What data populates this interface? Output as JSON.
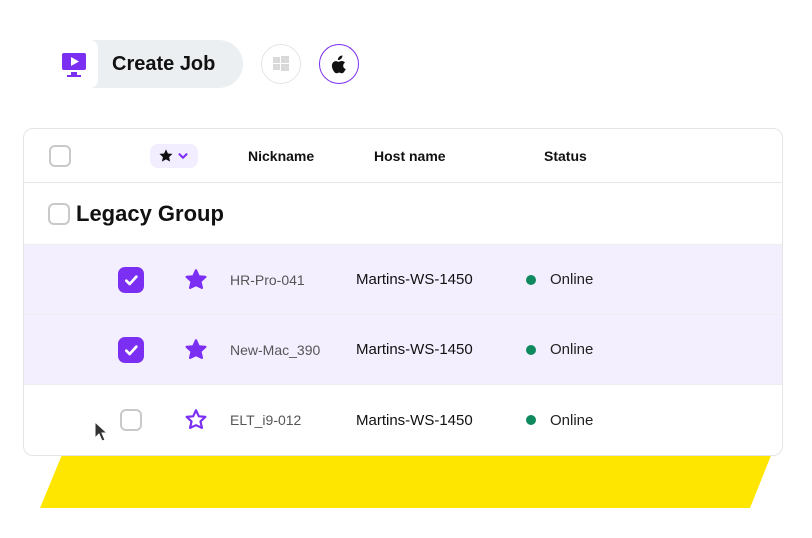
{
  "toolbar": {
    "create_label": "Create Job"
  },
  "table": {
    "headers": {
      "nickname": "Nickname",
      "hostname": "Host name",
      "status": "Status"
    },
    "group": {
      "name": "Legacy Group"
    },
    "rows": [
      {
        "checked": true,
        "favorite": true,
        "nickname": "HR-Pro-041",
        "hostname": "Martins-WS-1450",
        "status": "Online",
        "selected": true
      },
      {
        "checked": true,
        "favorite": true,
        "nickname": "New-Mac_390",
        "hostname": "Martins-WS-1450",
        "status": "Online",
        "selected": true
      },
      {
        "checked": false,
        "favorite": false,
        "nickname": "ELT_i9-012",
        "hostname": "Martins-WS-1450",
        "status": "Online",
        "selected": false
      }
    ]
  },
  "colors": {
    "accent": "#7b2ff2",
    "highlight": "#ffe600",
    "status_online": "#0f8a5f"
  }
}
